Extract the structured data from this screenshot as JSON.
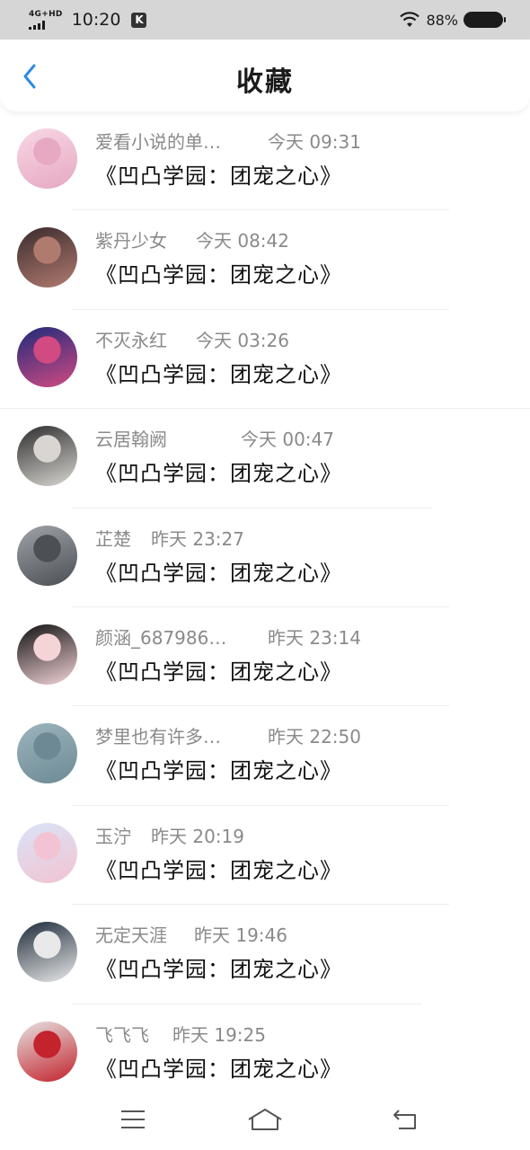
{
  "status_bar": {
    "network": "4G+HD",
    "time": "10:20",
    "app_badge": "K",
    "battery": "88%"
  },
  "header": {
    "title": "收藏",
    "back_icon": "chevron-left-icon"
  },
  "items": [
    {
      "user": "爱看小说的单…",
      "time": "今天 09:31",
      "title": "《凹凸学园：团宠之心》",
      "avatar_colors": [
        "#f7d7e4",
        "#e6a8c2"
      ]
    },
    {
      "user": "紫丹少女",
      "time": "今天 08:42",
      "title": "《凹凸学园：团宠之心》",
      "avatar_colors": [
        "#3a2b2d",
        "#b07b6f"
      ]
    },
    {
      "user": "不灭永红",
      "time": "今天 03:26",
      "title": "《凹凸学园：团宠之心》",
      "avatar_colors": [
        "#1f2a7a",
        "#d14a82"
      ]
    },
    {
      "user": "云居翰阙",
      "time": "今天 00:47",
      "title": "《凹凸学园：团宠之心》",
      "avatar_colors": [
        "#2e2e2e",
        "#d9d6d2"
      ]
    },
    {
      "user": "芷楚",
      "time": "昨天 23:27",
      "title": "《凹凸学园：团宠之心》",
      "avatar_colors": [
        "#9fa3a8",
        "#4c4f55"
      ]
    },
    {
      "user": "颜涵_687986…",
      "time": "昨天 23:14",
      "title": "《凹凸学园：团宠之心》",
      "avatar_colors": [
        "#111111",
        "#f5d4d8"
      ]
    },
    {
      "user": "梦里也有许多…",
      "time": "昨天 22:50",
      "title": "《凹凸学园：团宠之心》",
      "avatar_colors": [
        "#9cb4bd",
        "#6d8a94"
      ]
    },
    {
      "user": "玉泞",
      "time": "昨天 20:19",
      "title": "《凹凸学园：团宠之心》",
      "avatar_colors": [
        "#d9e4f7",
        "#f2c3d2"
      ]
    },
    {
      "user": "无定天涯",
      "time": "昨天 19:46",
      "title": "《凹凸学园：团宠之心》",
      "avatar_colors": [
        "#1e2b3a",
        "#e9e9e9"
      ]
    },
    {
      "user": "飞飞飞",
      "time": "昨天 19:25",
      "title": "《凹凸学园：团宠之心》",
      "avatar_colors": [
        "#e6e2e2",
        "#c2232c"
      ]
    }
  ],
  "nav_bar": {
    "menu_icon": "menu-icon",
    "home_icon": "home-icon",
    "back_icon": "back-icon"
  }
}
